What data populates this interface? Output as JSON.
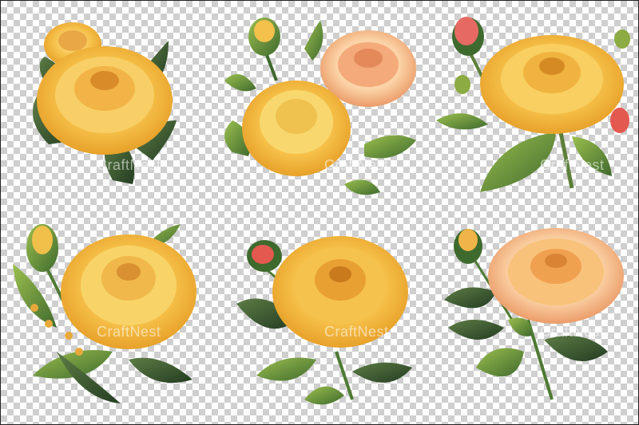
{
  "watermark": {
    "text": "CraftNest"
  },
  "colors": {
    "checker_dark": "#cfcfcf",
    "checker_light": "#ffffff",
    "petal_light": "#fde59a",
    "petal_mid": "#f6c14a",
    "petal_dark": "#e49a22",
    "peach_light": "#fbd3a6",
    "peach_dark": "#e88f5b",
    "leaf_light": "#9cbf4e",
    "leaf_dark": "#3f6a2e",
    "bud_red": "#e4594f"
  },
  "images": [
    {
      "subject": "yellow-peony-with-dark-leaves"
    },
    {
      "subject": "yellow-and-peach-peony-bouquet"
    },
    {
      "subject": "yellow-peony-with-pink-buds"
    },
    {
      "subject": "yellow-peony-with-small-buds"
    },
    {
      "subject": "golden-peony-with-red-bud"
    },
    {
      "subject": "peach-peony-with-bud"
    }
  ]
}
